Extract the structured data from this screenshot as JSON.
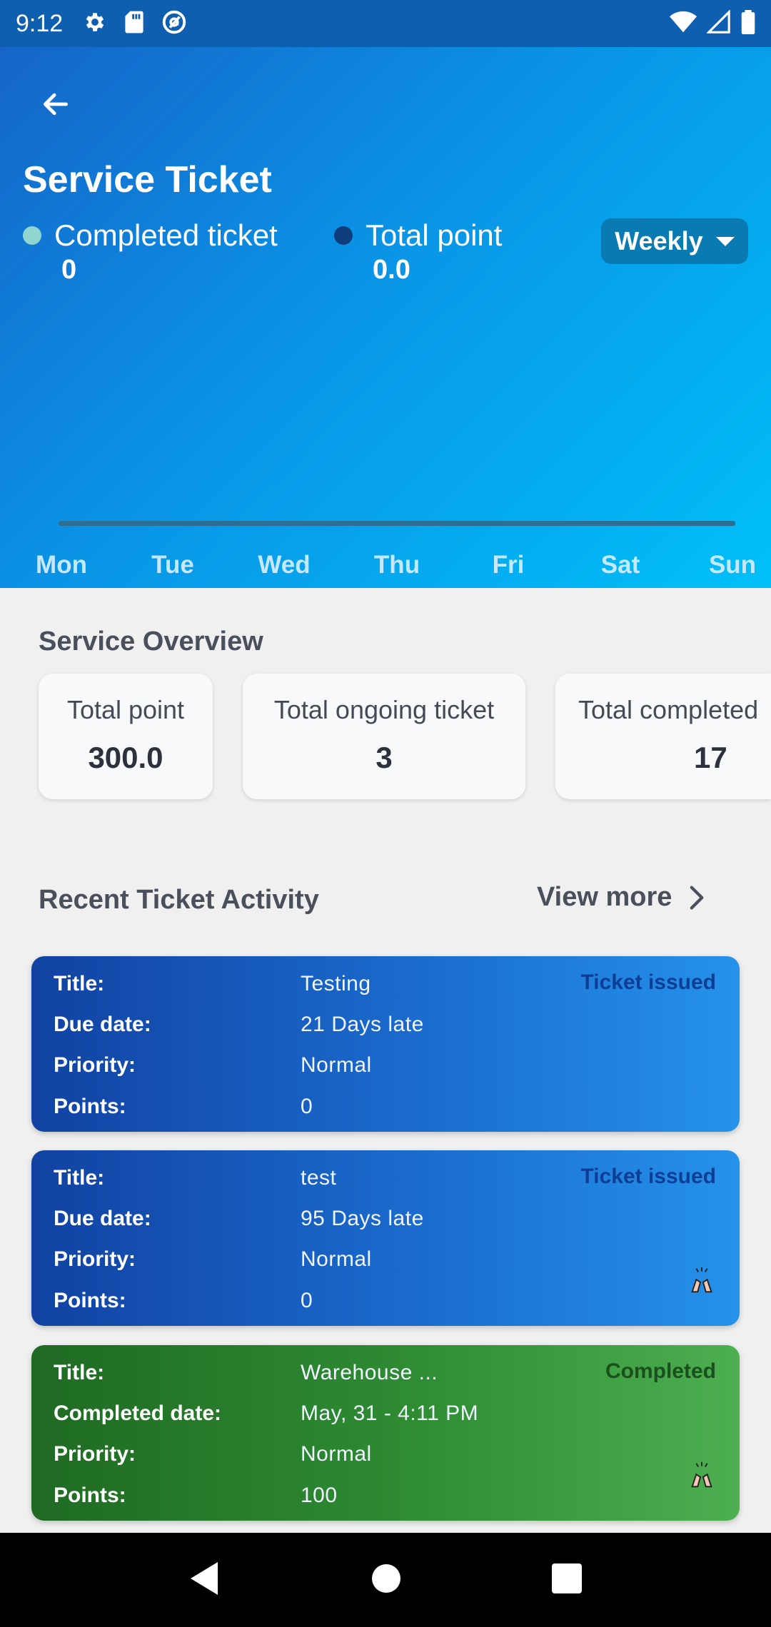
{
  "status_bar": {
    "time": "9:12"
  },
  "header": {
    "title": "Service Ticket",
    "legend": [
      {
        "label": "Completed ticket",
        "value": "0",
        "color": "#8fd6d0"
      },
      {
        "label": "Total point",
        "value": "0.0",
        "color": "#0d3d7a"
      }
    ],
    "period": {
      "selected": "Weekly"
    },
    "days": [
      "Mon",
      "Tue",
      "Wed",
      "Thu",
      "Fri",
      "Sat",
      "Sun"
    ]
  },
  "overview": {
    "title": "Service Overview",
    "cards": [
      {
        "label": "Total point",
        "value": "300.0"
      },
      {
        "label": "Total ongoing ticket",
        "value": "3"
      },
      {
        "label": "Total completed",
        "value": "17"
      }
    ]
  },
  "recent": {
    "title": "Recent Ticket Activity",
    "view_more": "View more",
    "tickets": [
      {
        "status": "Ticket issued",
        "rows": [
          {
            "key": "Title:",
            "value": "Testing"
          },
          {
            "key": "Due date:",
            "value": "21 Days late"
          },
          {
            "key": "Priority:",
            "value": "Normal"
          },
          {
            "key": "Points:",
            "value": "0"
          }
        ]
      },
      {
        "status": "Ticket issued",
        "rows": [
          {
            "key": "Title:",
            "value": "test"
          },
          {
            "key": "Due date:",
            "value": "95 Days late"
          },
          {
            "key": "Priority:",
            "value": "Normal"
          },
          {
            "key": "Points:",
            "value": "0"
          }
        ]
      },
      {
        "status": "Completed",
        "rows": [
          {
            "key": "Title:",
            "value": "Warehouse ..."
          },
          {
            "key": "Completed date:",
            "value": "May, 31 - 4:11 PM"
          },
          {
            "key": "Priority:",
            "value": "Normal"
          },
          {
            "key": "Points:",
            "value": "100"
          }
        ]
      }
    ]
  }
}
